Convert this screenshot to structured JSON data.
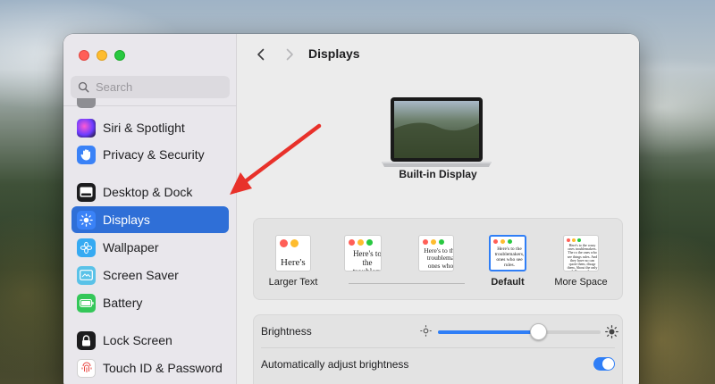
{
  "window": {
    "title": "Displays"
  },
  "sidebar": {
    "search": {
      "placeholder": "Search",
      "value": ""
    },
    "items": [
      {
        "label": "Siri & Spotlight",
        "icon": "siri-icon",
        "active": false
      },
      {
        "label": "Privacy & Security",
        "icon": "hand-icon",
        "active": false
      },
      {
        "label": "Desktop & Dock",
        "icon": "dock-icon",
        "active": false
      },
      {
        "label": "Displays",
        "icon": "sun-icon",
        "active": true
      },
      {
        "label": "Wallpaper",
        "icon": "flower-icon",
        "active": false
      },
      {
        "label": "Screen Saver",
        "icon": "screensaver-icon",
        "active": false
      },
      {
        "label": "Battery",
        "icon": "battery-icon",
        "active": false
      },
      {
        "label": "Lock Screen",
        "icon": "lock-icon",
        "active": false
      },
      {
        "label": "Touch ID & Password",
        "icon": "fingerprint-icon",
        "active": false
      }
    ]
  },
  "main": {
    "display_name": "Built-in Display",
    "resolution_options": [
      {
        "label": "Larger Text",
        "preview": "Here's",
        "selected": false
      },
      {
        "label": "",
        "preview": "Here's to the troublem",
        "selected": false
      },
      {
        "label": "",
        "preview": "Here's to the troublema ones who",
        "selected": false
      },
      {
        "label": "Default",
        "preview": "Here's to the troublemakers, ones who see rules.",
        "selected": true
      },
      {
        "label": "More Space",
        "preview": "Here's to the crazy ones troublemakers. The ro the ones who see things rules. And they have no can quote them, disagr them. About the only th Because they change t",
        "selected": false
      }
    ],
    "brightness": {
      "label": "Brightness",
      "level": 0.62
    },
    "auto_brightness": {
      "label": "Automatically adjust brightness",
      "enabled": true
    }
  },
  "colors": {
    "accent": "#2f6fd7",
    "toggle_on": "#2f7ef6",
    "annotation_arrow": "#e8312a"
  }
}
